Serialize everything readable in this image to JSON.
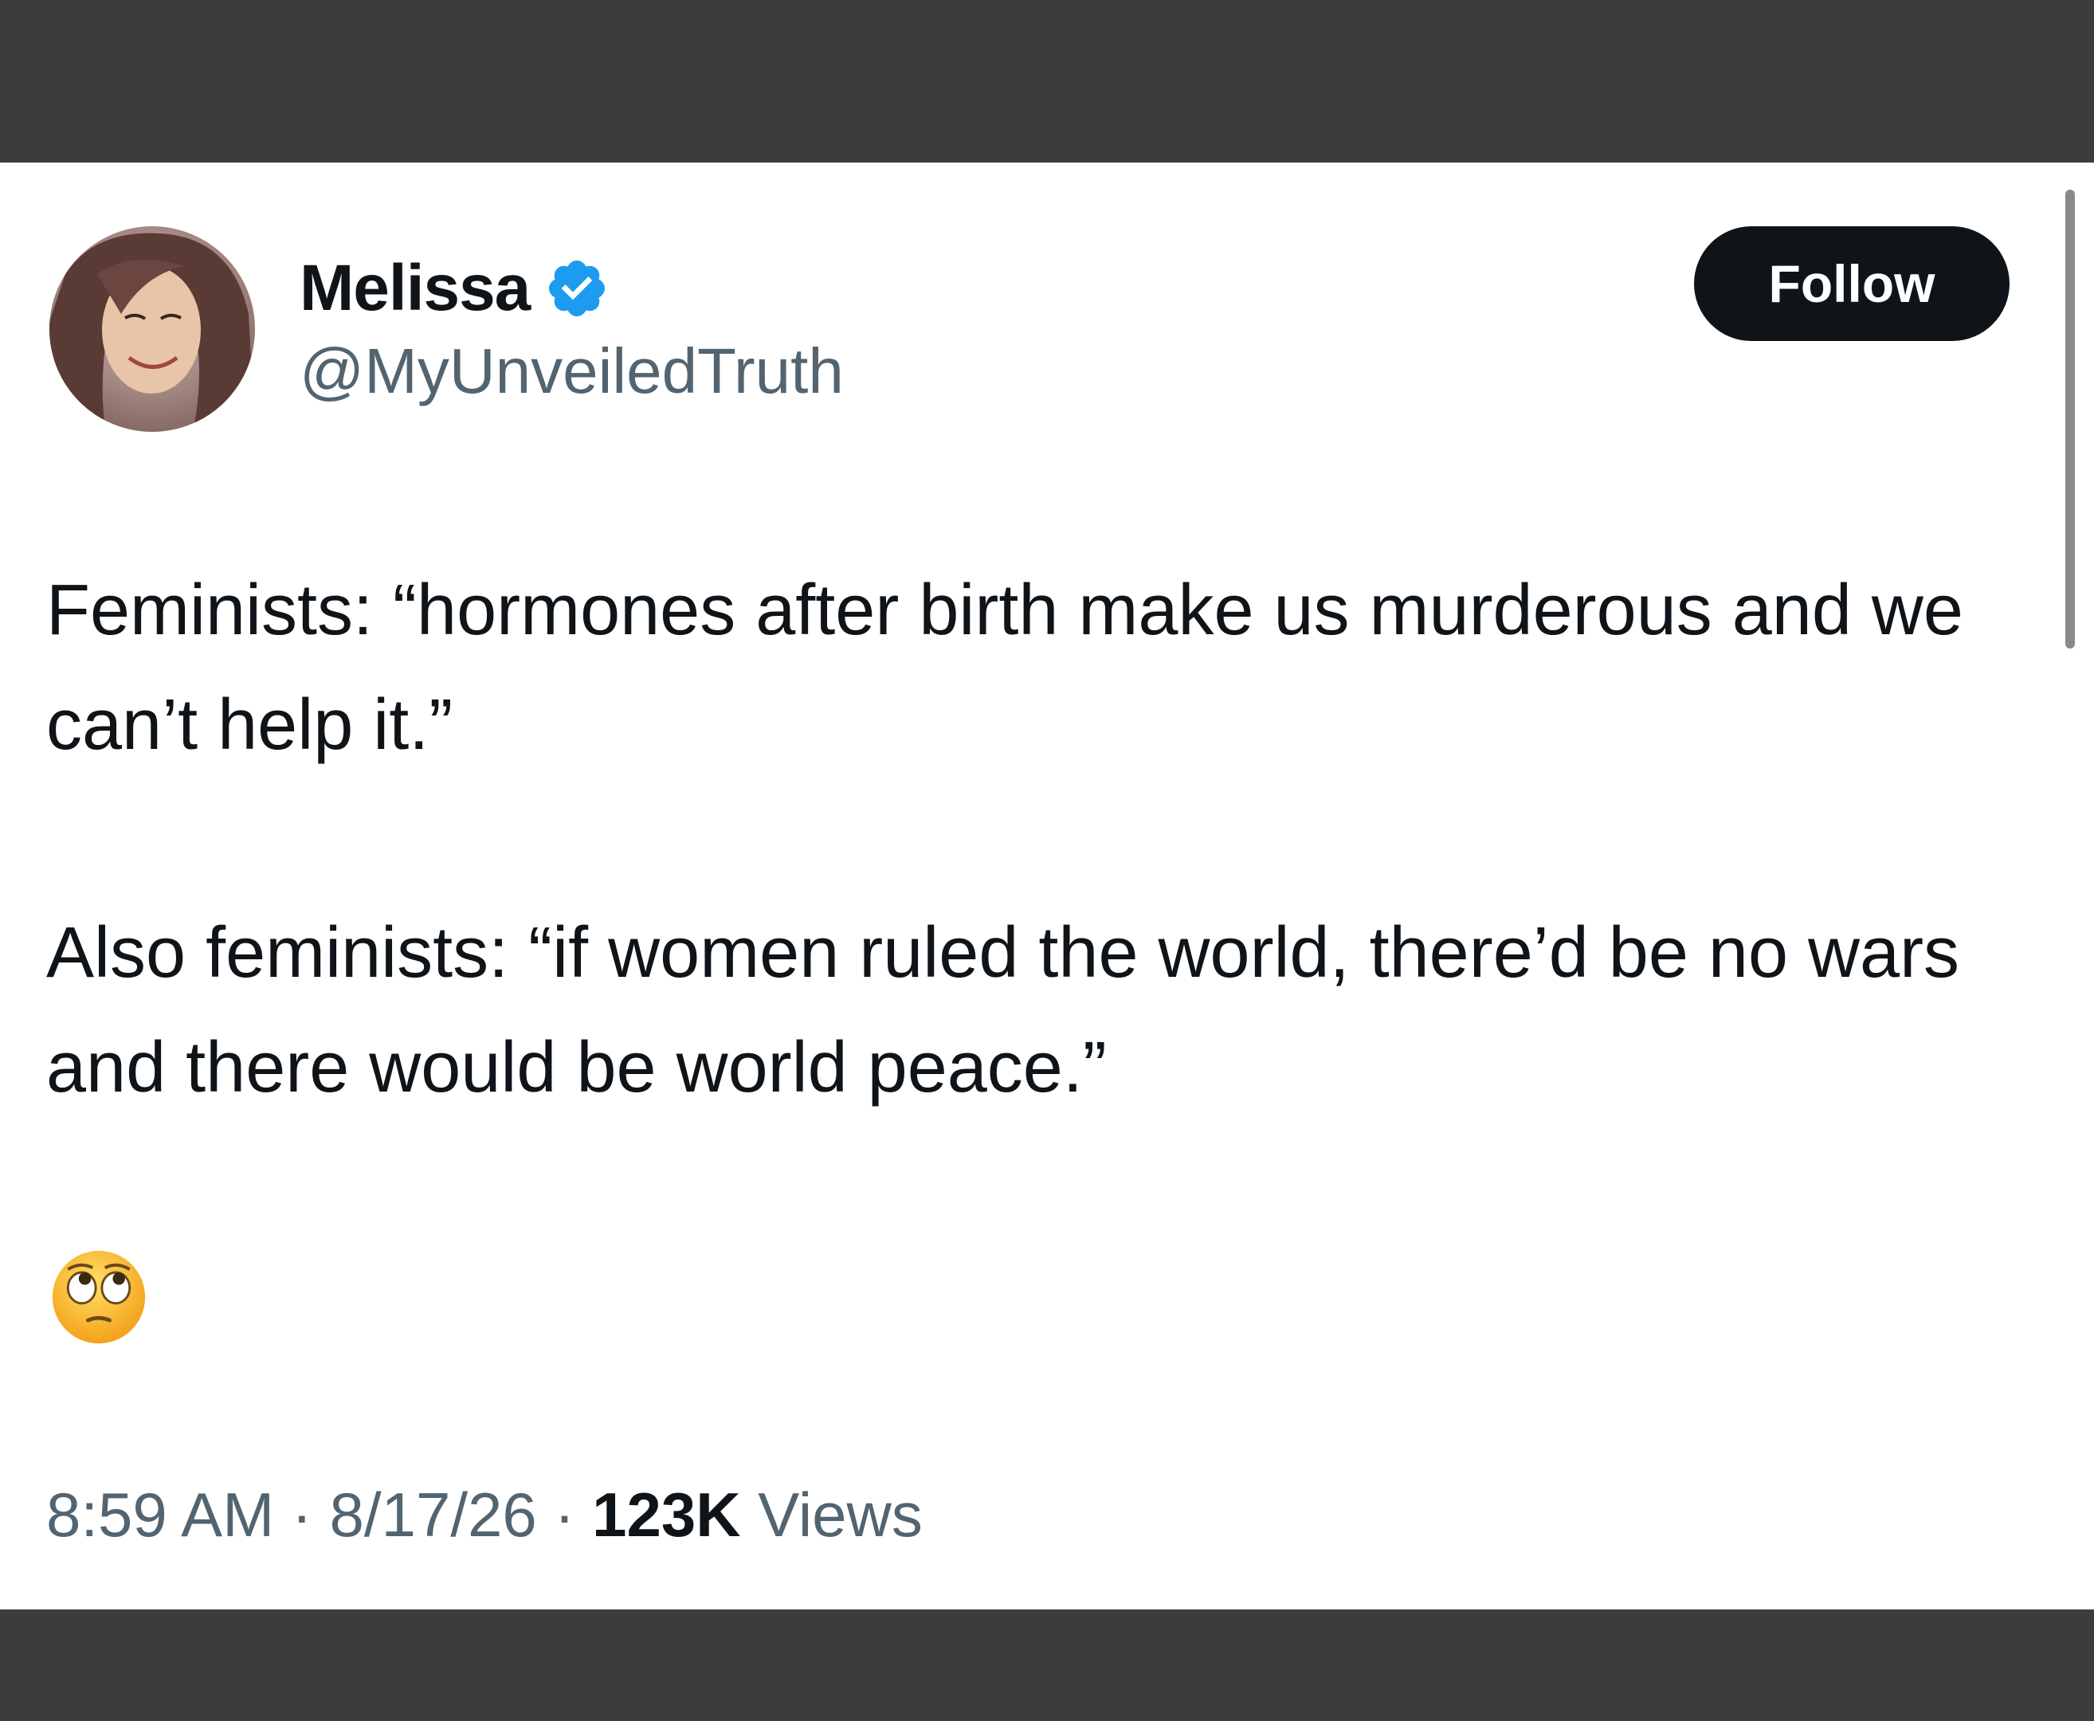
{
  "tweet": {
    "author": {
      "name": "Melissa",
      "handle": "@MyUnveiledTruth",
      "verified": true,
      "avatar_icon": "profile-photo"
    },
    "follow_label": "Follow",
    "paragraphs": [
      "Feminists: “hormones after birth make us murderous and we can’t help it.”",
      "Also feminists: “if women ruled the world, there’d be no wars and there would be world peace.”"
    ],
    "emoji": "face-with-rolling-eyes-icon",
    "time": "8:59 AM",
    "date": "8/17/26",
    "separator": "·",
    "views_count": "123K",
    "views_label": "Views"
  },
  "colors": {
    "text_primary": "#0f1419",
    "text_secondary": "#536471",
    "verified_blue": "#1d9bf0",
    "button_bg": "#0f1419",
    "frame_bg": "#3c3c3c"
  }
}
